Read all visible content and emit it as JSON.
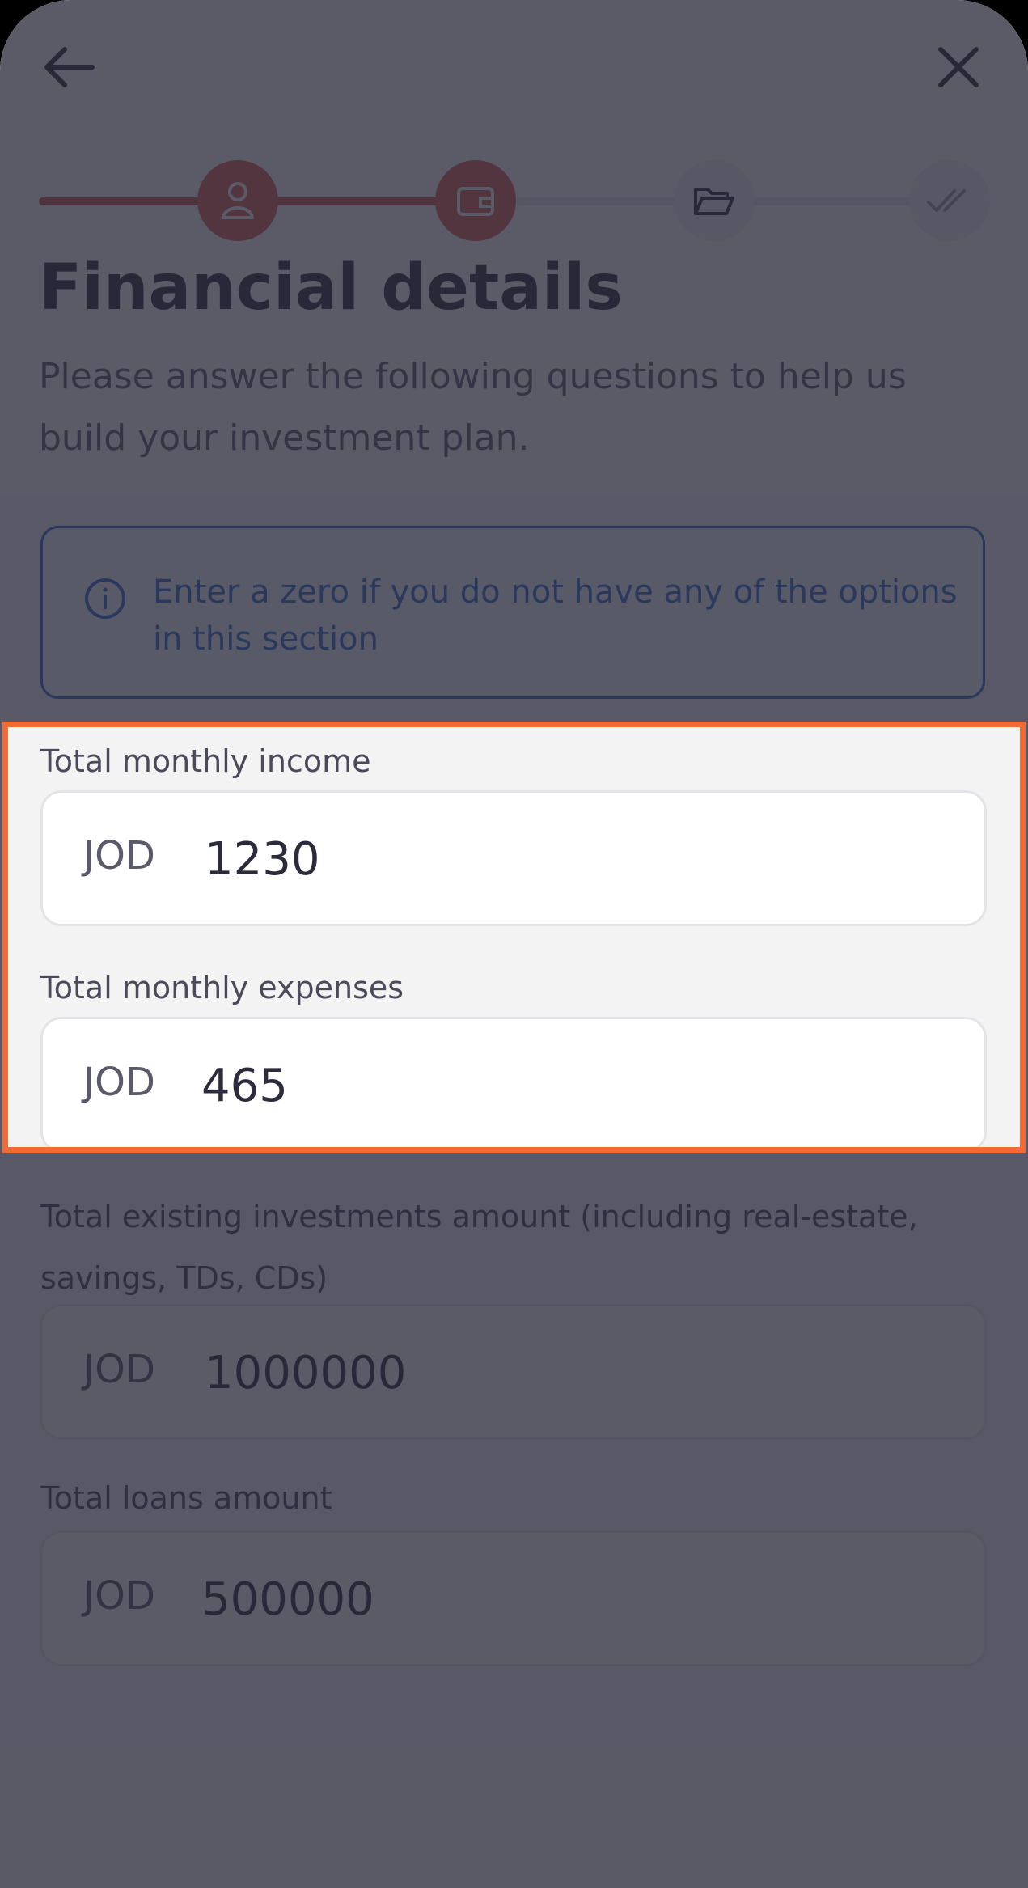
{
  "header": {
    "back_icon": "arrow-left-icon",
    "close_icon": "close-icon"
  },
  "stepper": {
    "steps": [
      {
        "icon": "user-icon",
        "state": "done"
      },
      {
        "icon": "wallet-icon",
        "state": "current"
      },
      {
        "icon": "folder-open-icon",
        "state": "todo"
      },
      {
        "icon": "double-check-icon",
        "state": "todo"
      }
    ],
    "accent_color": "#d9624f"
  },
  "page": {
    "title": "Financial details",
    "subtitle": "Please answer the following questions to help us build your investment plan."
  },
  "info": {
    "text": "Enter a zero if you do not have any of the options in this section",
    "color": "#2e6ccc"
  },
  "fields": [
    {
      "label": "Total monthly income",
      "currency": "JOD",
      "value": "1230"
    },
    {
      "label": "Total monthly expenses",
      "currency": "JOD",
      "value": "465"
    },
    {
      "label": "Total existing investments amount (including real-estate, savings, TDs, CDs)",
      "currency": "JOD",
      "value": "1000000"
    },
    {
      "label": "Total loans amount",
      "currency": "JOD",
      "value": "500000"
    }
  ],
  "highlight": {
    "color": "#f26a35"
  }
}
